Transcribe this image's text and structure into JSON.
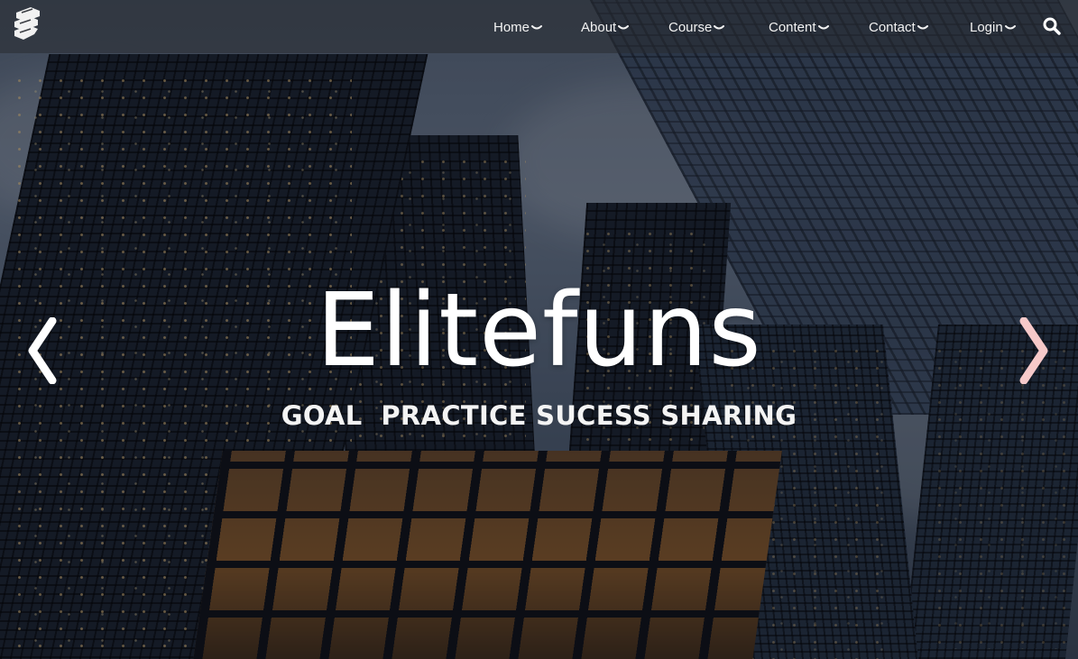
{
  "site": {
    "logo_icon": "shield-logo-icon"
  },
  "nav": {
    "items": [
      {
        "label": "Home",
        "icon": "chevron-down-icon"
      },
      {
        "label": "About",
        "icon": "chevron-down-icon"
      },
      {
        "label": "Course",
        "icon": "chevron-down-icon"
      },
      {
        "label": "Content",
        "icon": "chevron-down-icon"
      },
      {
        "label": "Contact",
        "icon": "chevron-down-icon"
      },
      {
        "label": "Login",
        "icon": "chevron-down-icon"
      }
    ],
    "search_icon": "search-icon"
  },
  "hero": {
    "title": "Elitefuns",
    "subtitle": "GOAL  PRACTICE SUCESS SHARING",
    "prev_icon": "chevron-left-icon",
    "next_icon": "chevron-right-icon"
  },
  "colors": {
    "text": "#ffffff",
    "navbar_bg": "#3a3d42",
    "next_arrow": "#f6c9c9",
    "prev_arrow": "#ffffff"
  }
}
